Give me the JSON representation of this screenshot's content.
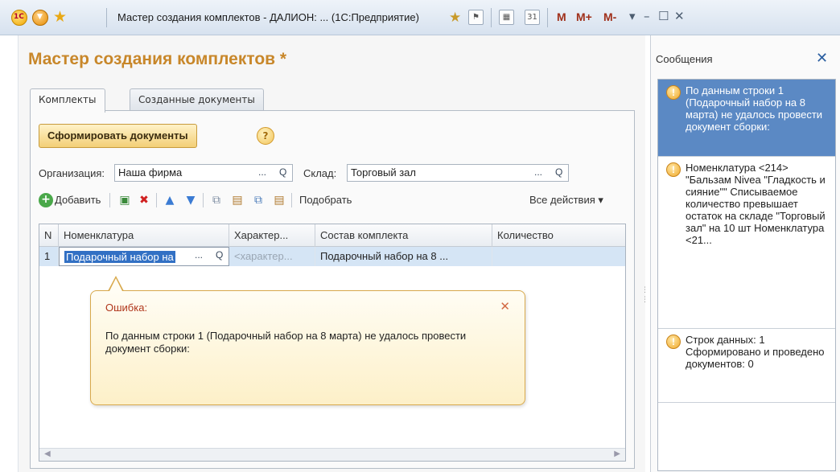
{
  "window": {
    "title": "Мастер создания комплектов - ДАЛИОН: ... (1С:Предприятие)",
    "logo_text": "1С",
    "m_buttons": [
      "M",
      "M+",
      "M-"
    ]
  },
  "page": {
    "title": "Мастер создания комплектов *"
  },
  "tabs": [
    {
      "label": "Комплекты",
      "active": true
    },
    {
      "label": "Созданные документы",
      "active": false
    }
  ],
  "actions": {
    "generate_label": "Сформировать документы",
    "help_glyph": "?"
  },
  "filters": {
    "org_label": "Организация:",
    "org_value": "Наша фирма",
    "warehouse_label": "Склад:",
    "warehouse_value": "Торговый зал",
    "select_glyph": "...",
    "search_glyph": "Q"
  },
  "toolbar": {
    "add_label": "Добавить",
    "select_label": "Подобрать",
    "all_actions_label": "Все действия ▾"
  },
  "grid": {
    "columns": [
      "N",
      "Номенклатура",
      "Характер...",
      "Состав комплекта",
      "Количество"
    ],
    "rows": [
      {
        "n": "1",
        "nomenclature": "Подарочный набор на",
        "characteristic": "<характер...",
        "composition": "Подарочный набор на 8 ...",
        "quantity": ""
      }
    ]
  },
  "error_balloon": {
    "title": "Ошибка:",
    "text": "По данным строки 1 (Подарочный набор на 8 марта) не удалось провести документ сборки:"
  },
  "messages": {
    "title": "Сообщения",
    "items": [
      {
        "text": "По данным строки 1 (Подарочный набор на 8 марта) не удалось провести документ сборки:",
        "selected": true
      },
      {
        "text": "Номенклатура <214> \"Бальзам Nivea \"Гладкость и сияние\"\" Списываемое количество превышает остаток на складе \"Торговый зал\" на 10 шт Номенклатура <21...",
        "selected": false
      },
      {
        "text": "Строк данных: 1 Сформировано и проведено документов: 0",
        "selected": false
      }
    ]
  },
  "colors": {
    "title_accent": "#c8872a",
    "selection": "#5b89c4",
    "error_title": "#b0361b"
  }
}
